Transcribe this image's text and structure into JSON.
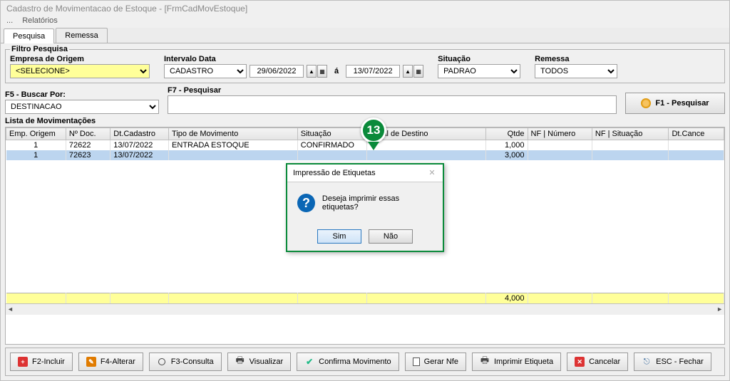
{
  "window": {
    "title": "Cadastro de Movimentacao de Estoque - [FrmCadMovEstoque]"
  },
  "menu": {
    "item1": "...",
    "item2": "Relatórios"
  },
  "tabs": {
    "pesquisa": "Pesquisa",
    "remessa": "Remessa"
  },
  "filter": {
    "legend": "Filtro Pesquisa",
    "empresa": {
      "label": "Empresa de Origem",
      "value": "<SELECIONE>"
    },
    "intervalo": {
      "label": "Intervalo Data",
      "tipo": "CADASTRO",
      "de": "29/06/2022",
      "a": "á",
      "ate": "13/07/2022"
    },
    "situacao": {
      "label": "Situação",
      "value": "PADRAO"
    },
    "remessa": {
      "label": "Remessa",
      "value": "TODOS"
    }
  },
  "search": {
    "buscar_label": "F5 - Buscar Por:",
    "buscar_value": "DESTINACAO",
    "pesquisar_label": "F7 - Pesquisar",
    "pesquisar_value": "",
    "button": "F1 - Pesquisar"
  },
  "grid": {
    "label": "Lista de Movimentações",
    "cols": {
      "emp": "Emp. Origem",
      "doc": "Nº Doc.",
      "dt": "Dt.Cadastro",
      "tipo": "Tipo de Movimento",
      "sit": "Situação",
      "dest": "Local de Destino",
      "qtde": "Qtde",
      "nfnum": "NF | Número",
      "nfsit": "NF | Situação",
      "dtcanc": "Dt.Cance"
    },
    "rows": [
      {
        "emp": "1",
        "doc": "72622",
        "dt": "13/07/2022",
        "tipo": "ENTRADA ESTOQUE",
        "sit": "CONFIRMADO",
        "dest": "",
        "qtde": "1,000",
        "nfnum": "",
        "nfsit": "",
        "dtcanc": ""
      },
      {
        "emp": "1",
        "doc": "72623",
        "dt": "13/07/2022",
        "tipo": "",
        "sit": "",
        "dest": "",
        "qtde": "3,000",
        "nfnum": "",
        "nfsit": "",
        "dtcanc": ""
      }
    ],
    "footer": {
      "qtde": "4,000"
    }
  },
  "buttons": {
    "incluir": "F2-Incluir",
    "alterar": "F4-Alterar",
    "consulta": "F3-Consulta",
    "visualizar": "Visualizar",
    "confirma": "Confirma Movimento",
    "nfe": "Gerar Nfe",
    "etiqueta": "Imprimir Etiqueta",
    "cancelar": "Cancelar",
    "fechar": "ESC - Fechar"
  },
  "dialog": {
    "title": "Impressão de Etiquetas",
    "message": "Deseja imprimir essas etiquetas?",
    "yes": "Sim",
    "no": "Não"
  },
  "pin": {
    "number": "13"
  }
}
